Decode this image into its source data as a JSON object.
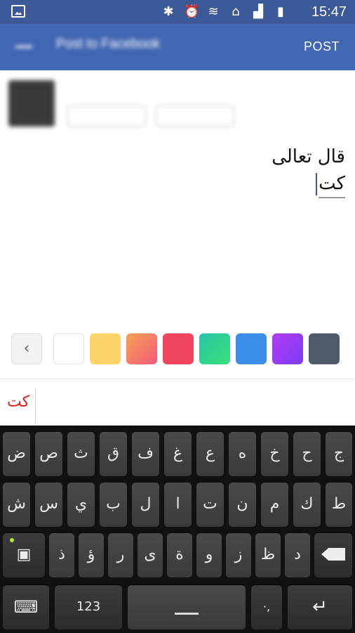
{
  "status_bar": {
    "time": "15:47",
    "icons": [
      "gallery-notification-icon",
      "bluetooth-icon",
      "alarm-icon",
      "wifi-icon",
      "home-icon",
      "signal-icon",
      "battery-icon"
    ]
  },
  "app_bar": {
    "title": "Post to Facebook",
    "post_label": "POST"
  },
  "composer": {
    "line1": "قال تعالى",
    "line2": "كت"
  },
  "color_swatches": [
    {
      "name": "white",
      "value": "#ffffff"
    },
    {
      "name": "yellow",
      "value": "#fcd46b"
    },
    {
      "name": "orange-gradient",
      "value": "linear-gradient(135deg,#f7a154,#f45b7a)"
    },
    {
      "name": "red",
      "value": "#f0455f"
    },
    {
      "name": "teal-gradient",
      "value": "linear-gradient(135deg,#2ac4a6,#37e07a)"
    },
    {
      "name": "blue",
      "value": "#3b8ee8"
    },
    {
      "name": "purple-gradient",
      "value": "linear-gradient(135deg,#b13cf1,#7c3cf6)"
    },
    {
      "name": "slate",
      "value": "#4f5b6b"
    }
  ],
  "color_back_label": "‹",
  "suggestion": "كت",
  "keyboard": {
    "row1": [
      "ض",
      "ص",
      "ث",
      "ق",
      "ف",
      "غ",
      "ع",
      "ه",
      "خ",
      "ح",
      "ج"
    ],
    "row2": [
      "ش",
      "س",
      "ي",
      "ب",
      "ل",
      "ا",
      "ت",
      "ن",
      "م",
      "ك",
      "ط"
    ],
    "row3": [
      "ذ",
      "ؤ",
      "ر",
      "ى",
      "ة",
      "و",
      "ز",
      "ظ",
      "د"
    ],
    "numbers_label": "123",
    "punct_label": "·,"
  }
}
